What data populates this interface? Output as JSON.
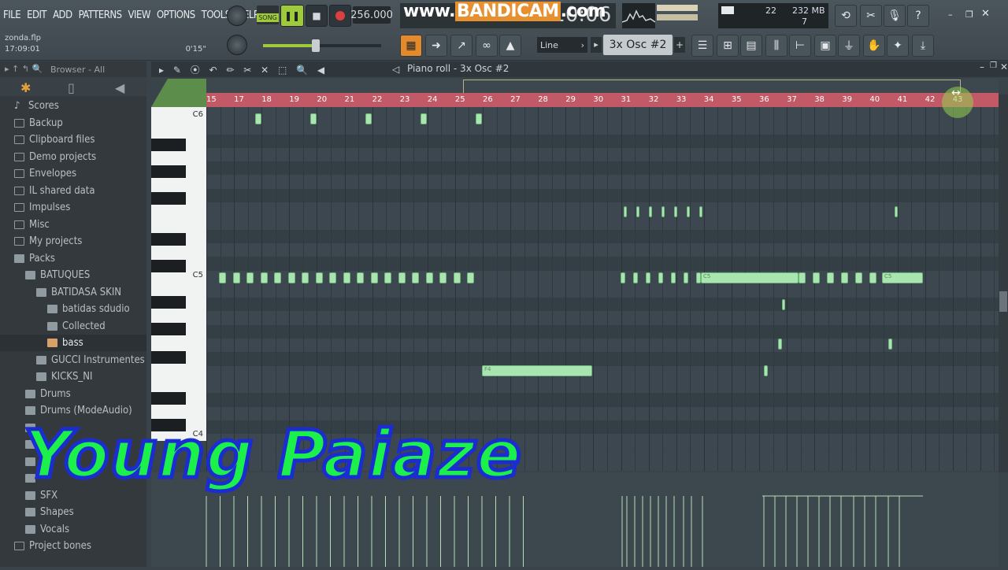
{
  "menu": [
    "FILE",
    "EDIT",
    "ADD",
    "PATTERNS",
    "VIEW",
    "OPTIONS",
    "TOOLS",
    "HELP"
  ],
  "hint": {
    "file": "zonda.flp",
    "time": "17:09:01",
    "elapsed": "0'15\""
  },
  "transport": {
    "mode": "SONG",
    "tempo": "256.000"
  },
  "watermark": {
    "prefix": "www.",
    "brand": "BANDICAM",
    "suffix": ".com"
  },
  "clock": "1:10:06",
  "memory": {
    "value": "232 MB",
    "cpu": "22",
    "voices": "7"
  },
  "snap": "Line",
  "pattern": "3x Osc #2",
  "browser": {
    "title": "Browser - All",
    "items": [
      {
        "label": "Scores",
        "indent": 0,
        "type": "score"
      },
      {
        "label": "Backup",
        "indent": 0,
        "type": "folder"
      },
      {
        "label": "Clipboard files",
        "indent": 0,
        "type": "folder"
      },
      {
        "label": "Demo projects",
        "indent": 0,
        "type": "folder"
      },
      {
        "label": "Envelopes",
        "indent": 0,
        "type": "folder"
      },
      {
        "label": "IL shared data",
        "indent": 0,
        "type": "folder"
      },
      {
        "label": "Impulses",
        "indent": 0,
        "type": "folder"
      },
      {
        "label": "Misc",
        "indent": 0,
        "type": "folder"
      },
      {
        "label": "My projects",
        "indent": 0,
        "type": "folder"
      },
      {
        "label": "Packs",
        "indent": 0,
        "type": "open"
      },
      {
        "label": "BATUQUES",
        "indent": 1,
        "type": "open"
      },
      {
        "label": "BATIDASA SKIN",
        "indent": 2,
        "type": "open"
      },
      {
        "label": "batidas sdudio",
        "indent": 3,
        "type": "open"
      },
      {
        "label": "Collected",
        "indent": 3,
        "type": "open"
      },
      {
        "label": "bass",
        "indent": 3,
        "type": "file",
        "selected": true
      },
      {
        "label": "GUCCI Instrumentes",
        "indent": 2,
        "type": "open"
      },
      {
        "label": "KICKS_NI",
        "indent": 2,
        "type": "open"
      },
      {
        "label": "Drums",
        "indent": 1,
        "type": "open"
      },
      {
        "label": "Drums (ModeAudio)",
        "indent": 1,
        "type": "open"
      },
      {
        "label": "",
        "indent": 1,
        "type": "open"
      },
      {
        "label": "",
        "indent": 1,
        "type": "open"
      },
      {
        "label": "",
        "indent": 1,
        "type": "open"
      },
      {
        "label": "",
        "indent": 1,
        "type": "open"
      },
      {
        "label": "SFX",
        "indent": 1,
        "type": "open"
      },
      {
        "label": "Shapes",
        "indent": 1,
        "type": "open"
      },
      {
        "label": "Vocals",
        "indent": 1,
        "type": "open"
      },
      {
        "label": "Project bones",
        "indent": 0,
        "type": "folder"
      }
    ]
  },
  "pianoroll": {
    "title": "Piano roll - 3x Osc #2",
    "bars": [
      "15",
      "17",
      "18",
      "19",
      "20",
      "21",
      "22",
      "23",
      "24",
      "25",
      "26",
      "27",
      "28",
      "29",
      "30",
      "31",
      "32",
      "33",
      "34",
      "35",
      "36",
      "37",
      "38",
      "39",
      "40",
      "41",
      "42",
      "43"
    ],
    "key_labels": [
      "C6",
      "C5",
      "C4"
    ],
    "note_labels": {
      "c5": "C5",
      "f4": "F4"
    }
  },
  "banner": "Young Paiaze"
}
